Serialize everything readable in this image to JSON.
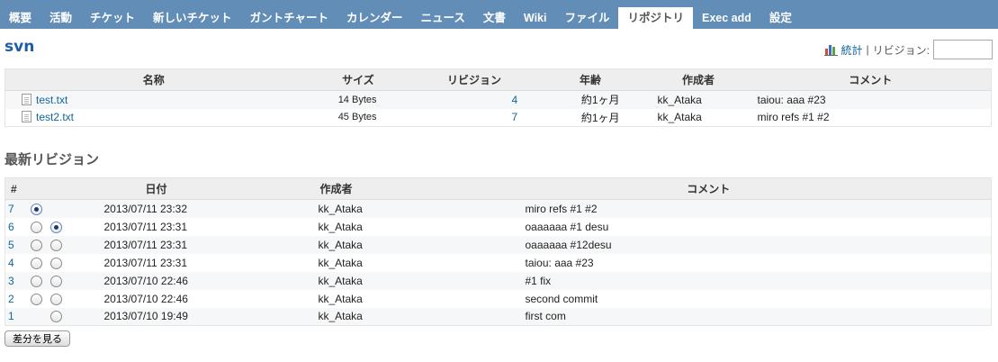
{
  "menu": {
    "items": [
      {
        "label": "概要"
      },
      {
        "label": "活動"
      },
      {
        "label": "チケット"
      },
      {
        "label": "新しいチケット"
      },
      {
        "label": "ガントチャート"
      },
      {
        "label": "カレンダー"
      },
      {
        "label": "ニュース"
      },
      {
        "label": "文書"
      },
      {
        "label": "Wiki"
      },
      {
        "label": "ファイル"
      },
      {
        "label": "リポジトリ",
        "selected": true
      },
      {
        "label": "Exec add"
      },
      {
        "label": "設定"
      }
    ]
  },
  "repository": {
    "title": "svn",
    "stats_label": "統計",
    "separator": "|",
    "revision_label": "リビジョン:",
    "revision_value": ""
  },
  "entries": {
    "headers": {
      "name": "名称",
      "size": "サイズ",
      "revision": "リビジョン",
      "age": "年齢",
      "author": "作成者",
      "comment": "コメント"
    },
    "rows": [
      {
        "name": "test.txt",
        "size": "14 Bytes",
        "revision": "4",
        "age": "約1ヶ月",
        "author": "kk_Ataka",
        "comment": "taiou: aaa #23"
      },
      {
        "name": "test2.txt",
        "size": "45 Bytes",
        "revision": "7",
        "age": "約1ヶ月",
        "author": "kk_Ataka",
        "comment": "miro refs #1 #2"
      }
    ]
  },
  "latest": {
    "title": "最新リビジョン",
    "headers": {
      "num": "#",
      "date": "日付",
      "author": "作成者",
      "comment": "コメント"
    },
    "rows": [
      {
        "num": "7",
        "date": "2013/07/11 23:32",
        "author": "kk_Ataka",
        "comment": "miro refs #1 #2",
        "radio1": "checked",
        "radio2": "none"
      },
      {
        "num": "6",
        "date": "2013/07/11 23:31",
        "author": "kk_Ataka",
        "comment": "oaaaaaa #1 desu",
        "radio1": "unchecked",
        "radio2": "checked"
      },
      {
        "num": "5",
        "date": "2013/07/11 23:31",
        "author": "kk_Ataka",
        "comment": "oaaaaaa #12desu",
        "radio1": "unchecked",
        "radio2": "unchecked"
      },
      {
        "num": "4",
        "date": "2013/07/11 23:31",
        "author": "kk_Ataka",
        "comment": "taiou: aaa #23",
        "radio1": "unchecked",
        "radio2": "unchecked"
      },
      {
        "num": "3",
        "date": "2013/07/10 22:46",
        "author": "kk_Ataka",
        "comment": "#1 fix",
        "radio1": "unchecked",
        "radio2": "unchecked"
      },
      {
        "num": "2",
        "date": "2013/07/10 22:46",
        "author": "kk_Ataka",
        "comment": "second commit",
        "radio1": "unchecked",
        "radio2": "unchecked"
      },
      {
        "num": "1",
        "date": "2013/07/10 19:49",
        "author": "kk_Ataka",
        "comment": "first com",
        "radio1": "none",
        "radio2": "unchecked"
      }
    ],
    "diff_button": "差分を見る"
  },
  "icons": {
    "stats": "bar-chart-icon",
    "file": "text-file-icon"
  },
  "colors": {
    "menu_bg": "#628db6",
    "link": "#169",
    "title": "#1d5da8",
    "odd_row": "#f6f7f8",
    "header_bg": "#eeeeee"
  }
}
